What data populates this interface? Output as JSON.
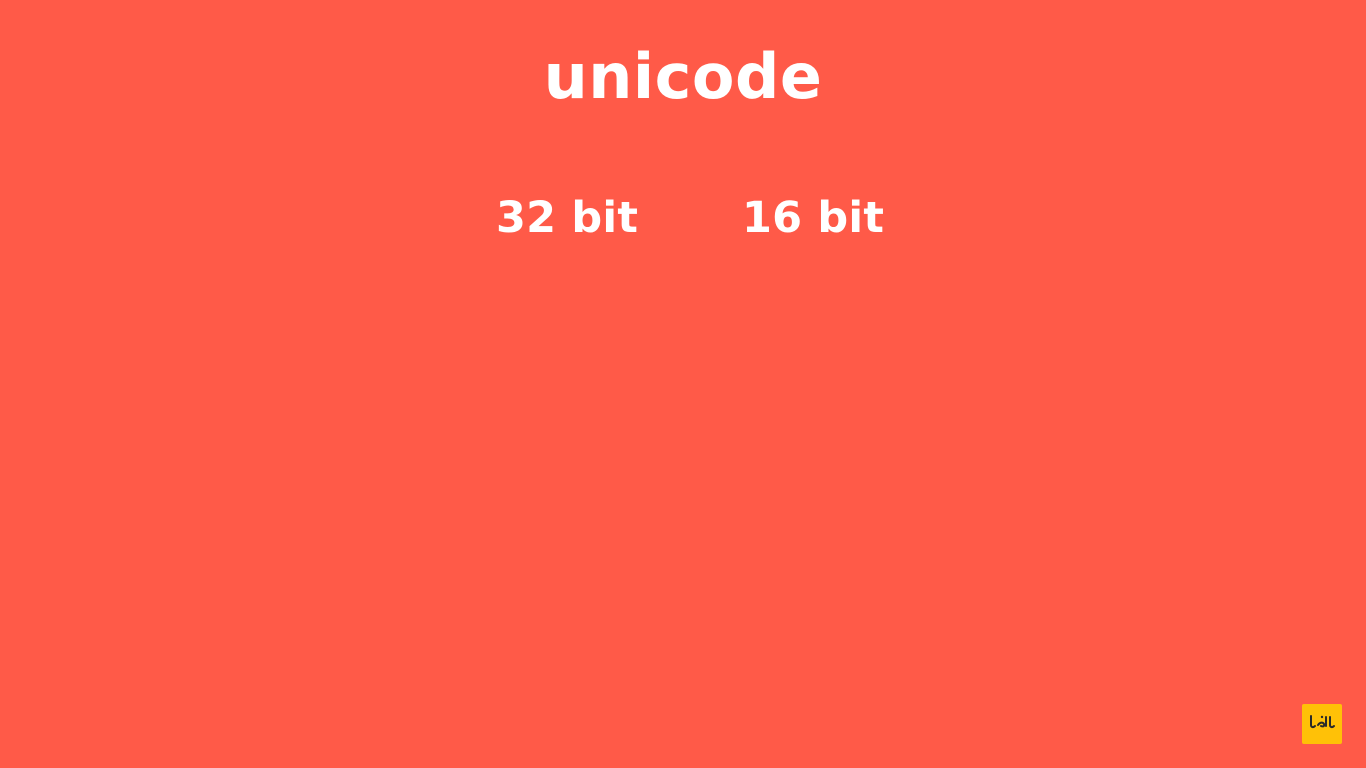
{
  "slide": {
    "title": "unicode",
    "left_label": "32 bit",
    "right_label": "16 bit"
  },
  "watermark": {
    "logo_text": "جالل",
    "background_color": "#ffc107"
  },
  "colors": {
    "background": "#ff5a48",
    "text": "#ffffff"
  }
}
